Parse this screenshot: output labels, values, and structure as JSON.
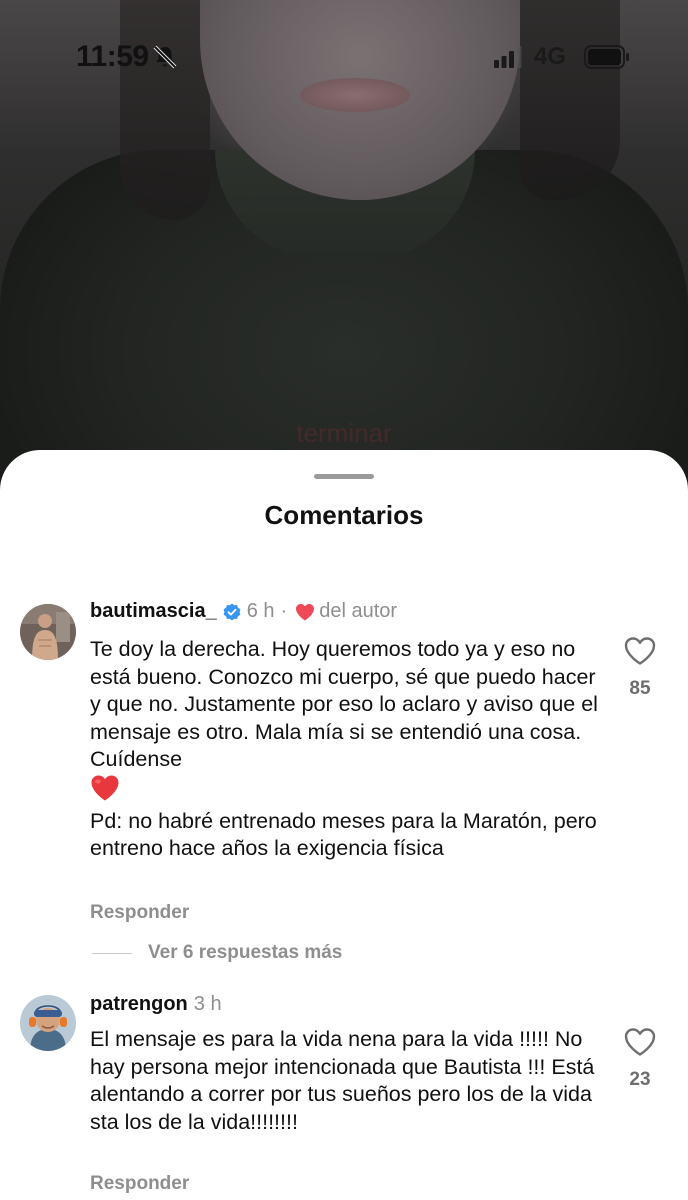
{
  "status_bar": {
    "time": "11:59",
    "network": "4G"
  },
  "video": {
    "overlay_text": "terminar"
  },
  "sheet": {
    "title": "Comentarios"
  },
  "comments": [
    {
      "username": "bautimascia_",
      "verified": true,
      "time": "6 h",
      "author_like_label": "del autor",
      "text_paragraph_1": "Te doy la derecha. Hoy queremos todo ya y eso no está bueno. Conozco mi cuerpo, sé que puedo hacer y que no. Justamente por eso lo aclaro y aviso que el mensaje es otro. Mala mía si se entendió una cosa. Cuídense",
      "text_paragraph_2": "Pd: no habré entrenado meses para la Maratón, pero entreno hace años la exigencia física",
      "emoji": "red-heart-icon",
      "reply_label": "Responder",
      "likes": "85",
      "more_replies_label": "Ver 6 respuestas más"
    },
    {
      "username": "patrengon",
      "time": "3 h",
      "text_paragraph_1": "El mensaje es para la vida nena para la vida !!!!! No hay persona mejor intencionada que Bautista !!! Está alentando a correr por tus sueños pero los de la vida sta los de la vida!!!!!!!!",
      "reply_label": "Responder",
      "likes": "23"
    }
  ],
  "colors": {
    "accent_verified": "#3897f0",
    "heart_red": "#ed4956",
    "muted_text": "#8e8e8e"
  }
}
